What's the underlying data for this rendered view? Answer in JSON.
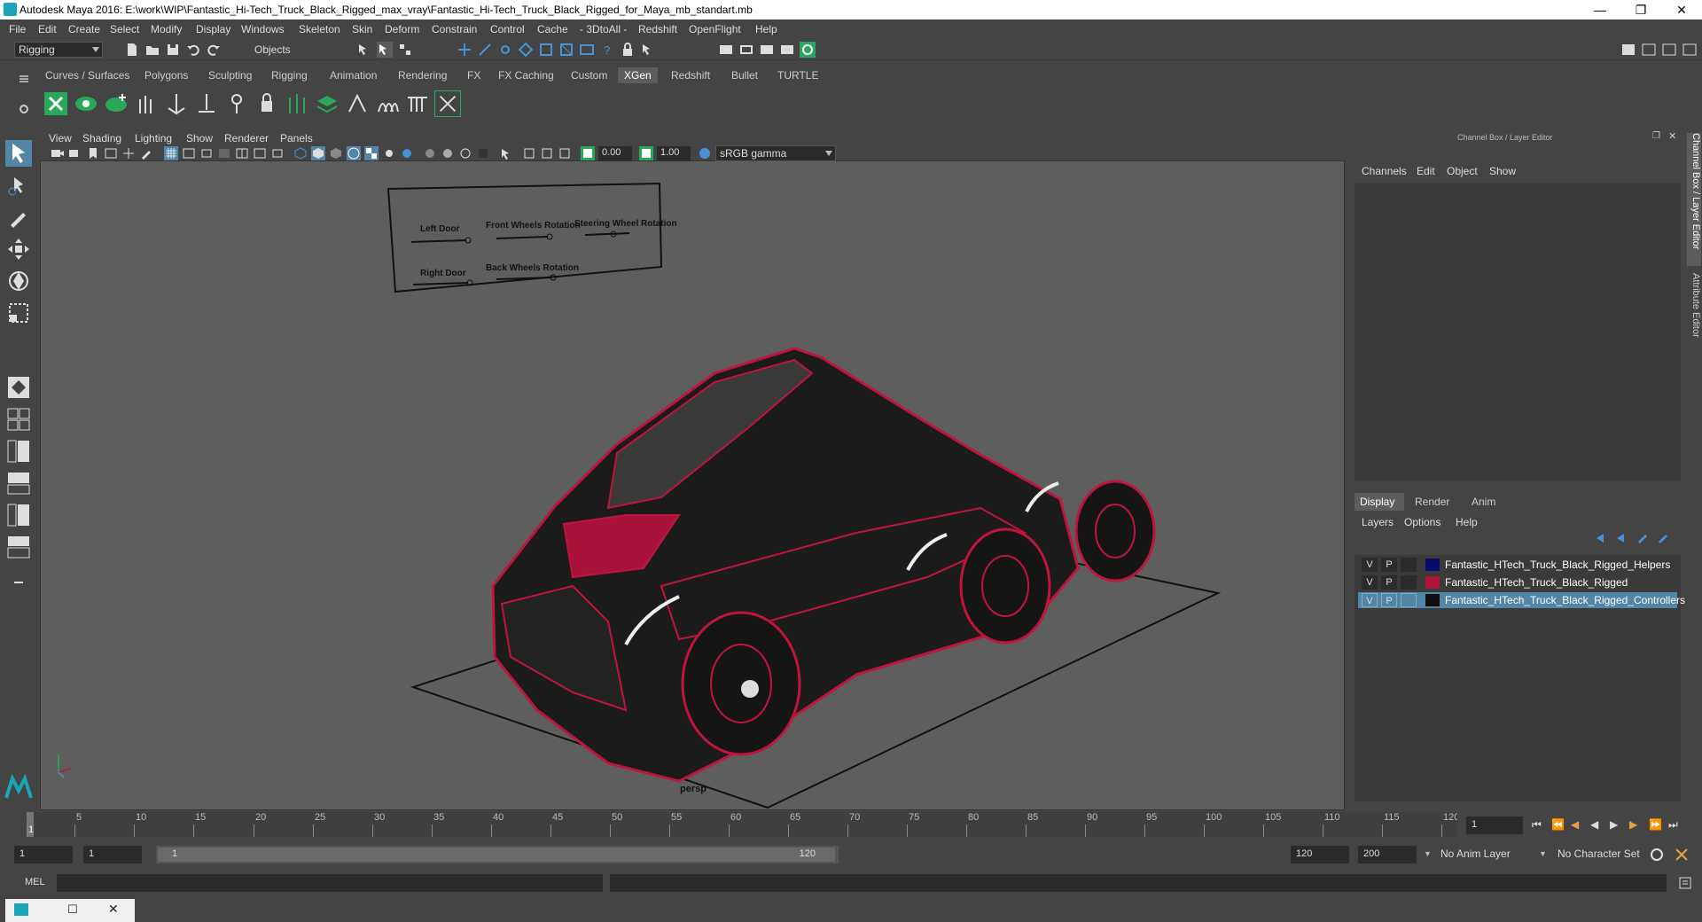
{
  "window": {
    "title": "Autodesk Maya 2016: E:\\work\\WIP\\Fantastic_Hi-Tech_Truck_Black_Rigged_max_vray\\Fantastic_Hi-Tech_Truck_Black_Rigged_for_Maya_mb_standart.mb"
  },
  "menubar": [
    "File",
    "Edit",
    "Create",
    "Select",
    "Modify",
    "Display",
    "Windows",
    "Skeleton",
    "Skin",
    "Deform",
    "Constrain",
    "Control",
    "Cache",
    "- 3DtoAll -",
    "Redshift",
    "OpenFlight",
    "Help"
  ],
  "statusline": {
    "mode": "Rigging",
    "select_mode": "Objects"
  },
  "shelf_tabs": [
    "Curves / Surfaces",
    "Polygons",
    "Sculpting",
    "Rigging",
    "Animation",
    "Rendering",
    "FX",
    "FX Caching",
    "Custom",
    "XGen",
    "Redshift",
    "Bullet",
    "TURTLE"
  ],
  "shelf_active": "XGen",
  "viewport": {
    "menu": [
      "View",
      "Shading",
      "Lighting",
      "Show",
      "Renderer",
      "Panels"
    ],
    "field_a": "0.00",
    "field_b": "1.00",
    "color_space": "sRGB gamma",
    "camera_label": "persp",
    "control_panel_labels": [
      "Left Door",
      "Front Wheels Rotation",
      "Steering Wheel Rotation",
      "Right Door",
      "Back Wheels Rotation"
    ]
  },
  "channel_box": {
    "title": "Channel Box / Layer Editor",
    "menu": [
      "Channels",
      "Edit",
      "Object",
      "Show"
    ],
    "layer_tabs": [
      "Display",
      "Render",
      "Anim"
    ],
    "layer_tab_active": "Display",
    "layer_menu": [
      "Layers",
      "Options",
      "Help"
    ],
    "layers": [
      {
        "v": "V",
        "p": "P",
        "name": "Fantastic_HTech_Truck_Black_Rigged_Helpers",
        "color": "#0a0a6e",
        "selected": false
      },
      {
        "v": "V",
        "p": "P",
        "name": "Fantastic_HTech_Truck_Black_Rigged",
        "color": "#b0123a",
        "selected": false
      },
      {
        "v": "V",
        "p": "P",
        "name": "Fantastic_HTech_Truck_Black_Rigged_Controllers",
        "color": "#101010",
        "selected": true
      }
    ]
  },
  "side_tabs": [
    "Channel Box / Layer Editor",
    "Attribute Editor"
  ],
  "timeline": {
    "ticks": [
      "1",
      "5",
      "10",
      "15",
      "20",
      "25",
      "30",
      "35",
      "40",
      "45",
      "50",
      "55",
      "60",
      "65",
      "70",
      "75",
      "80",
      "85",
      "90",
      "95",
      "100",
      "105",
      "110",
      "115",
      "120"
    ],
    "current_frame": "1"
  },
  "range": {
    "start": "1",
    "playback_start": "1",
    "slider_start": "1",
    "slider_end": "120",
    "playback_end": "120",
    "end": "200",
    "anim_layer": "No Anim Layer",
    "character_set": "No Character Set"
  },
  "cmdline": {
    "label": "MEL"
  },
  "colors": {
    "wire": "#c0143c",
    "viewport_bg": "#5e5e5e",
    "selection": "#5285a6",
    "active_icon": "#2aa85a"
  }
}
